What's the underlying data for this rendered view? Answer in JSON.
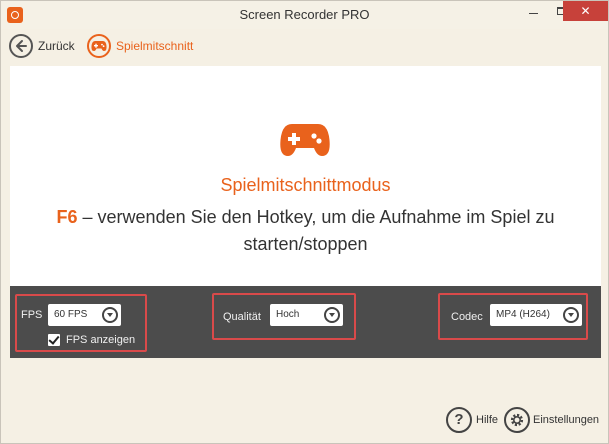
{
  "window": {
    "title": "Screen Recorder PRO",
    "minimize_icon": "minimize-icon",
    "maximize_icon": "maximize-icon",
    "close_icon": "close-icon",
    "close_glyph": "✕"
  },
  "nav": {
    "back_label": "Zurück",
    "mode_label": "Spielmitschnitt"
  },
  "content": {
    "mode_title": "Spielmitschnittmodus",
    "hotkey_key": "F6",
    "hotkey_text": " – verwenden Sie den Hotkey, um die Aufnahme im Spiel zu starten/stoppen"
  },
  "settings": {
    "fps_label": "FPS",
    "fps_value": "60 FPS",
    "show_fps_label": "FPS anzeigen",
    "show_fps_checked": true,
    "quality_label": "Qualität",
    "quality_value": "Hoch",
    "codec_label": "Codec",
    "codec_value": "MP4 (H264)"
  },
  "footer": {
    "help_glyph": "?",
    "help_label": "Hilfe",
    "settings_label": "Einstellungen"
  },
  "colors": {
    "accent": "#e9621c",
    "highlight_border": "#d94a4a",
    "settings_bar": "#4c4c4c",
    "background": "#f5f0e4"
  }
}
